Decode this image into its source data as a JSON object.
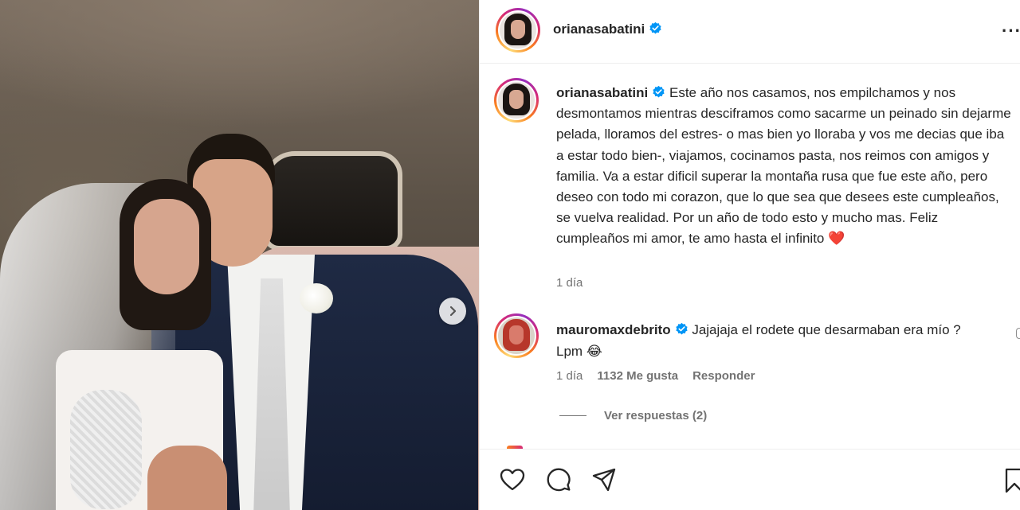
{
  "post": {
    "photo_alt": "Bride and groom in the back seat of a car",
    "next_label": "›"
  },
  "header": {
    "username": "orianasabatini",
    "more_label": "···"
  },
  "caption": {
    "username": "orianasabatini",
    "text": "Este año nos casamos, nos empilchamos y nos desmontamos mientras desciframos como sacarme un peinado sin dejarme pelada, lloramos del estres- o mas bien yo lloraba y vos me decias que iba a estar todo bien-, viajamos, cocinamos pasta, nos reimos con amigos y familia. Va a estar dificil superar la montaña rusa que fue este año, pero deseo con todo mi corazon, que lo que sea que desees este cumpleaños, se vuelva realidad. Por un año de todo esto y mucho mas. Feliz cumpleaños mi amor, te amo hasta el infinito",
    "emoji": "❤️",
    "time": "1 día"
  },
  "comment": {
    "username": "mauromaxdebrito",
    "text": "Jajajaja el rodete que desarmaban era mío ? Lpm",
    "emoji": "😂",
    "time": "1 día",
    "likes": "1132 Me gusta",
    "reply_label": "Responder",
    "view_replies": "Ver respuestas (2)"
  },
  "actions": {
    "icons": [
      "heart-icon",
      "comment-icon",
      "share-icon",
      "bookmark-icon"
    ]
  },
  "colors": {
    "verified": "#0095f6",
    "text": "#262626",
    "muted": "#737373",
    "heart": "#ed4956"
  }
}
